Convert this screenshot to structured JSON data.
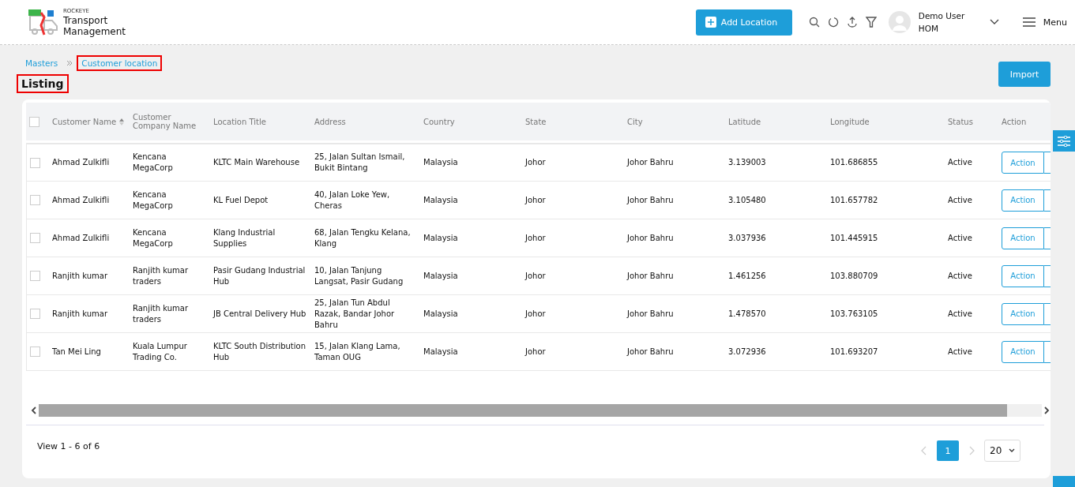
{
  "brand": {
    "small": "ROCKEYE",
    "line1": "Transport",
    "line2": "Management"
  },
  "header": {
    "add_button": "Add Location",
    "user_name": "Demo User",
    "user_role": "HOM",
    "menu": "Menu"
  },
  "breadcrumb": [
    {
      "label": "Masters",
      "highlighted": false
    },
    {
      "label": "Customer location",
      "highlighted": true
    }
  ],
  "page_title": {
    "text": "Listing",
    "highlighted": true
  },
  "import_button": "Import",
  "table": {
    "all_checked": false,
    "columns": [
      {
        "label": "Customer Name",
        "sortable": true
      },
      {
        "label": "Customer Company Name",
        "sortable": false
      },
      {
        "label": "Location Title",
        "sortable": false
      },
      {
        "label": "Address",
        "sortable": false
      },
      {
        "label": "Country",
        "sortable": false
      },
      {
        "label": "State",
        "sortable": false
      },
      {
        "label": "City",
        "sortable": false
      },
      {
        "label": "Latitude",
        "sortable": false
      },
      {
        "label": "Longitude",
        "sortable": false
      },
      {
        "label": "Status",
        "sortable": false
      },
      {
        "label": "Action",
        "sortable": false
      }
    ],
    "rows": [
      {
        "checked": false,
        "cells": [
          "Ahmad Zulkifli",
          "Kencana MegaCorp",
          "KLTC Main Warehouse",
          "25, Jalan Sultan Ismail, Bukit Bintang",
          "Malaysia",
          "Johor",
          "Johor Bahru",
          "3.139003",
          "101.686855",
          "Active"
        ],
        "action": "Action"
      },
      {
        "checked": false,
        "cells": [
          "Ahmad Zulkifli",
          "Kencana MegaCorp",
          "KL Fuel Depot",
          "40, Jalan Loke Yew, Cheras",
          "Malaysia",
          "Johor",
          "Johor Bahru",
          "3.105480",
          "101.657782",
          "Active"
        ],
        "action": "Action"
      },
      {
        "checked": false,
        "cells": [
          "Ahmad Zulkifli",
          "Kencana MegaCorp",
          "Klang Industrial Supplies",
          "68, Jalan Tengku Kelana, Klang",
          "Malaysia",
          "Johor",
          "Johor Bahru",
          "3.037936",
          "101.445915",
          "Active"
        ],
        "action": "Action"
      },
      {
        "checked": false,
        "cells": [
          "Ranjith kumar",
          "Ranjith kumar traders",
          "Pasir Gudang Industrial Hub",
          "10, Jalan Tanjung Langsat, Pasir Gudang",
          "Malaysia",
          "Johor",
          "Johor Bahru",
          "1.461256",
          "103.880709",
          "Active"
        ],
        "action": "Action"
      },
      {
        "checked": false,
        "cells": [
          "Ranjith kumar",
          "Ranjith kumar traders",
          "JB Central Delivery Hub",
          "25, Jalan Tun Abdul Razak, Bandar Johor Bahru",
          "Malaysia",
          "Johor",
          "Johor Bahru",
          "1.478570",
          "103.763105",
          "Active"
        ],
        "action": "Action"
      },
      {
        "checked": false,
        "cells": [
          "Tan Mei Ling",
          "Kuala Lumpur Trading Co.",
          "KLTC South Distribution Hub",
          "15, Jalan Klang Lama, Taman OUG",
          "Malaysia",
          "Johor",
          "Johor Bahru",
          "3.072936",
          "101.693207",
          "Active"
        ],
        "action": "Action"
      }
    ]
  },
  "footer": {
    "summary": "View 1 - 6 of 6",
    "pages": [
      {
        "label": "1",
        "selected": true
      }
    ],
    "page_size": "20"
  }
}
